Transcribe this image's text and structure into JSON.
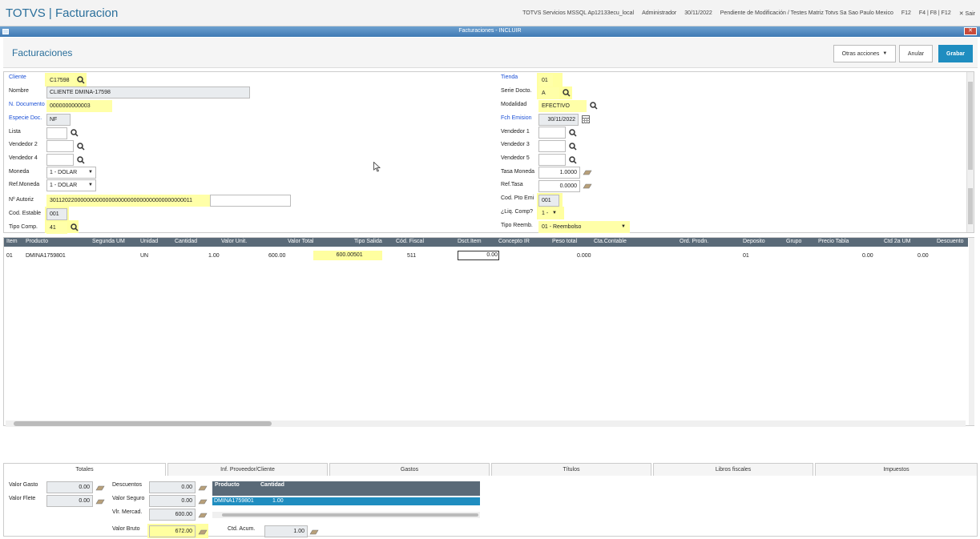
{
  "app": {
    "title": "TOTVS | Facturacion"
  },
  "topbar": {
    "items": [
      "TOTVS Servicios MSSQL Ap12133ecu_local",
      "Administrador",
      "30/11/2022",
      "Pendiente de Modificación / Testes Matriz Totvs Sa Sao Paulo Mexico",
      "F12",
      "F4 | F8 | F12"
    ],
    "exit": "✕ Sair"
  },
  "window": {
    "title": "Facturaciones - INCLUIR",
    "close": "✕"
  },
  "header": {
    "title": "Facturaciones",
    "other_actions": "Otras acciones",
    "cancel": "Anular",
    "save": "Grabar"
  },
  "form": {
    "cliente": {
      "label": "Cliente",
      "value": "C17598"
    },
    "nombre": {
      "label": "Nombre",
      "value": "CLIENTE DMINA-17598"
    },
    "ndoc": {
      "label": "N. Documento",
      "value": "0000000000003"
    },
    "especie": {
      "label": "Especie Doc.",
      "value": "NF"
    },
    "lista": {
      "label": "Lista",
      "value": ""
    },
    "vend2": {
      "label": "Vendedor 2",
      "value": ""
    },
    "vend4": {
      "label": "Vendedor 4",
      "value": ""
    },
    "moneda": {
      "label": "Moneda",
      "value": "1 - DOLAR"
    },
    "refmoneda": {
      "label": "Ref.Moneda",
      "value": "1 - DOLAR"
    },
    "nautoriz": {
      "label": "Nº Autoriz",
      "value": "3011202200000000000000000000000000000000000011"
    },
    "codestable": {
      "label": "Cod. Estable",
      "value": "001"
    },
    "tipocomp": {
      "label": "Tipo Comp.",
      "value": "41"
    },
    "tienda": {
      "label": "Tienda",
      "value": "01"
    },
    "serie": {
      "label": "Serie Docto.",
      "value": "A"
    },
    "modalidad": {
      "label": "Modalidad",
      "value": "EFECTIVO"
    },
    "fchemision": {
      "label": "Fch Emision",
      "value": "30/11/2022"
    },
    "vend1": {
      "label": "Vendedor 1",
      "value": ""
    },
    "vend3": {
      "label": "Vendedor 3",
      "value": ""
    },
    "vend5": {
      "label": "Vendedor 5",
      "value": ""
    },
    "tasamoneda": {
      "label": "Tasa Moneda",
      "value": "1.0000"
    },
    "reftasa": {
      "label": "Ref.Tasa",
      "value": "0.0000"
    },
    "codptoemi": {
      "label": "Cod. Pto Emi",
      "value": "001"
    },
    "liqcomp": {
      "label": "¿Liq. Comp?",
      "value": "1 -"
    },
    "tiporeemb": {
      "label": "Tipo Reemb.",
      "value": "01 - Reembolso"
    }
  },
  "grid": {
    "headers": [
      "Item",
      "Producto",
      "Segunda UM",
      "Unidad",
      "Cantidad",
      "Valor Unit.",
      "Valor Total",
      "Tipo Salida",
      "Cód. Fiscal",
      "Dsct.Item",
      "Concepto IR",
      "Peso total",
      "Cta.Contable",
      "Ord. Prodn.",
      "Deposito",
      "Grupo",
      "Precio Tabla",
      "Ctd 2a UM",
      "Descuento"
    ],
    "rows": [
      {
        "item": "01",
        "producto": "DMINA1759801",
        "unidad": "UN",
        "cantidad": "1.00",
        "valorunit": "600.00",
        "valortotal": "600.00",
        "tiposalida": "501",
        "codfiscal": "511",
        "dsctitem": "0.00",
        "pesototal": "0.000",
        "deposito": "01",
        "preciotabla": "0.00",
        "ctd2": "0.00"
      }
    ]
  },
  "tabs": [
    "Totales",
    "Inf. Proveedor/Cliente",
    "Gastos",
    "Títulos",
    "Libros fiscales",
    "Impuestos"
  ],
  "totals": {
    "valorgasto": {
      "label": "Valor Gasto",
      "value": "0.00"
    },
    "valorflete": {
      "label": "Valor Flete",
      "value": "0.00"
    },
    "descuentos": {
      "label": "Descuentos",
      "value": "0.00"
    },
    "valorseguro": {
      "label": "Valor Seguro",
      "value": "0.00"
    },
    "vlrmercad": {
      "label": "Vlr. Mercad.",
      "value": "600.00"
    },
    "valorbruto": {
      "label": "Valor Bruto",
      "value": "672.00"
    },
    "ctdacum": {
      "label": "Ctd. Acum.",
      "value": "1.00"
    },
    "mini_headers": [
      "Producto",
      "Cantidad"
    ],
    "mini_row": [
      "DMINA1759801",
      "1.00"
    ]
  }
}
